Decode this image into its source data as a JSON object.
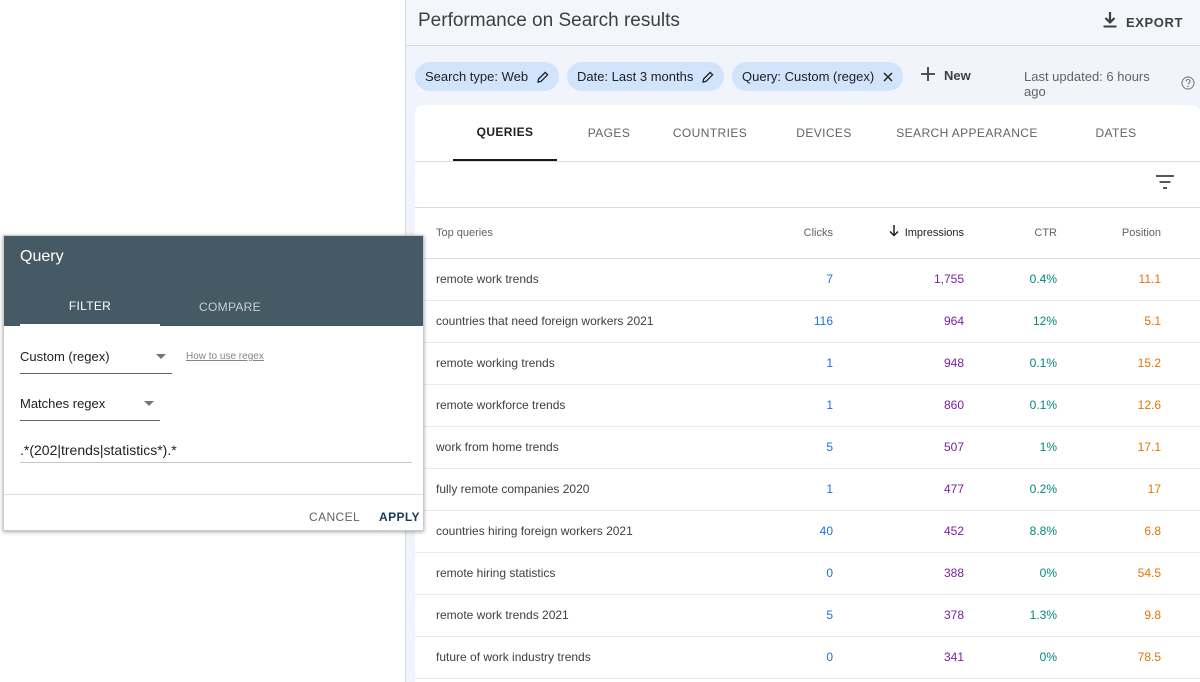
{
  "panel": {
    "title": "Performance on Search results",
    "export_label": "EXPORT",
    "export_icon": "download-icon",
    "chips": [
      {
        "label": "Search type: Web",
        "icon": "edit-icon"
      },
      {
        "label": "Date: Last 3 months",
        "icon": "edit-icon"
      },
      {
        "label": "Query: Custom (regex)",
        "icon": "close-icon"
      }
    ],
    "new_label": "New",
    "last_updated": "Last updated: 6 hours ago",
    "tabs": [
      "QUERIES",
      "PAGES",
      "COUNTRIES",
      "DEVICES",
      "SEARCH APPEARANCE",
      "DATES"
    ],
    "active_tab": "QUERIES"
  },
  "table": {
    "headers": {
      "query": "Top queries",
      "clicks": "Clicks",
      "impressions": "Impressions",
      "ctr": "CTR",
      "position": "Position"
    },
    "rows": [
      {
        "query": "remote work trends",
        "clicks": "7",
        "impressions": "1,755",
        "ctr": "0.4%",
        "position": "11.1"
      },
      {
        "query": "countries that need foreign workers 2021",
        "clicks": "116",
        "impressions": "964",
        "ctr": "12%",
        "position": "5.1"
      },
      {
        "query": "remote working trends",
        "clicks": "1",
        "impressions": "948",
        "ctr": "0.1%",
        "position": "15.2"
      },
      {
        "query": "remote workforce trends",
        "clicks": "1",
        "impressions": "860",
        "ctr": "0.1%",
        "position": "12.6"
      },
      {
        "query": "work from home trends",
        "clicks": "5",
        "impressions": "507",
        "ctr": "1%",
        "position": "17.1"
      },
      {
        "query": "fully remote companies 2020",
        "clicks": "1",
        "impressions": "477",
        "ctr": "0.2%",
        "position": "17"
      },
      {
        "query": "countries hiring foreign workers 2021",
        "clicks": "40",
        "impressions": "452",
        "ctr": "8.8%",
        "position": "6.8"
      },
      {
        "query": "remote hiring statistics",
        "clicks": "0",
        "impressions": "388",
        "ctr": "0%",
        "position": "54.5"
      },
      {
        "query": "remote work trends 2021",
        "clicks": "5",
        "impressions": "378",
        "ctr": "1.3%",
        "position": "9.8"
      },
      {
        "query": "future of work industry trends",
        "clicks": "0",
        "impressions": "341",
        "ctr": "0%",
        "position": "78.5"
      }
    ]
  },
  "dialog": {
    "title": "Query",
    "tabs": [
      "FILTER",
      "COMPARE"
    ],
    "active_tab": "FILTER",
    "filter_type": "Custom (regex)",
    "help_link": "How to use regex",
    "match_type": "Matches regex",
    "regex_value": ".*(202|trends|statistics*).*",
    "cancel_label": "CANCEL",
    "apply_label": "APPLY"
  },
  "colors": {
    "clicks": "#1a73e8",
    "impressions": "#7b1fa2",
    "ctr": "#00897b",
    "position": "#e37400",
    "dialog_header": "#455a64",
    "chip_bg": "#d2e3fc"
  }
}
